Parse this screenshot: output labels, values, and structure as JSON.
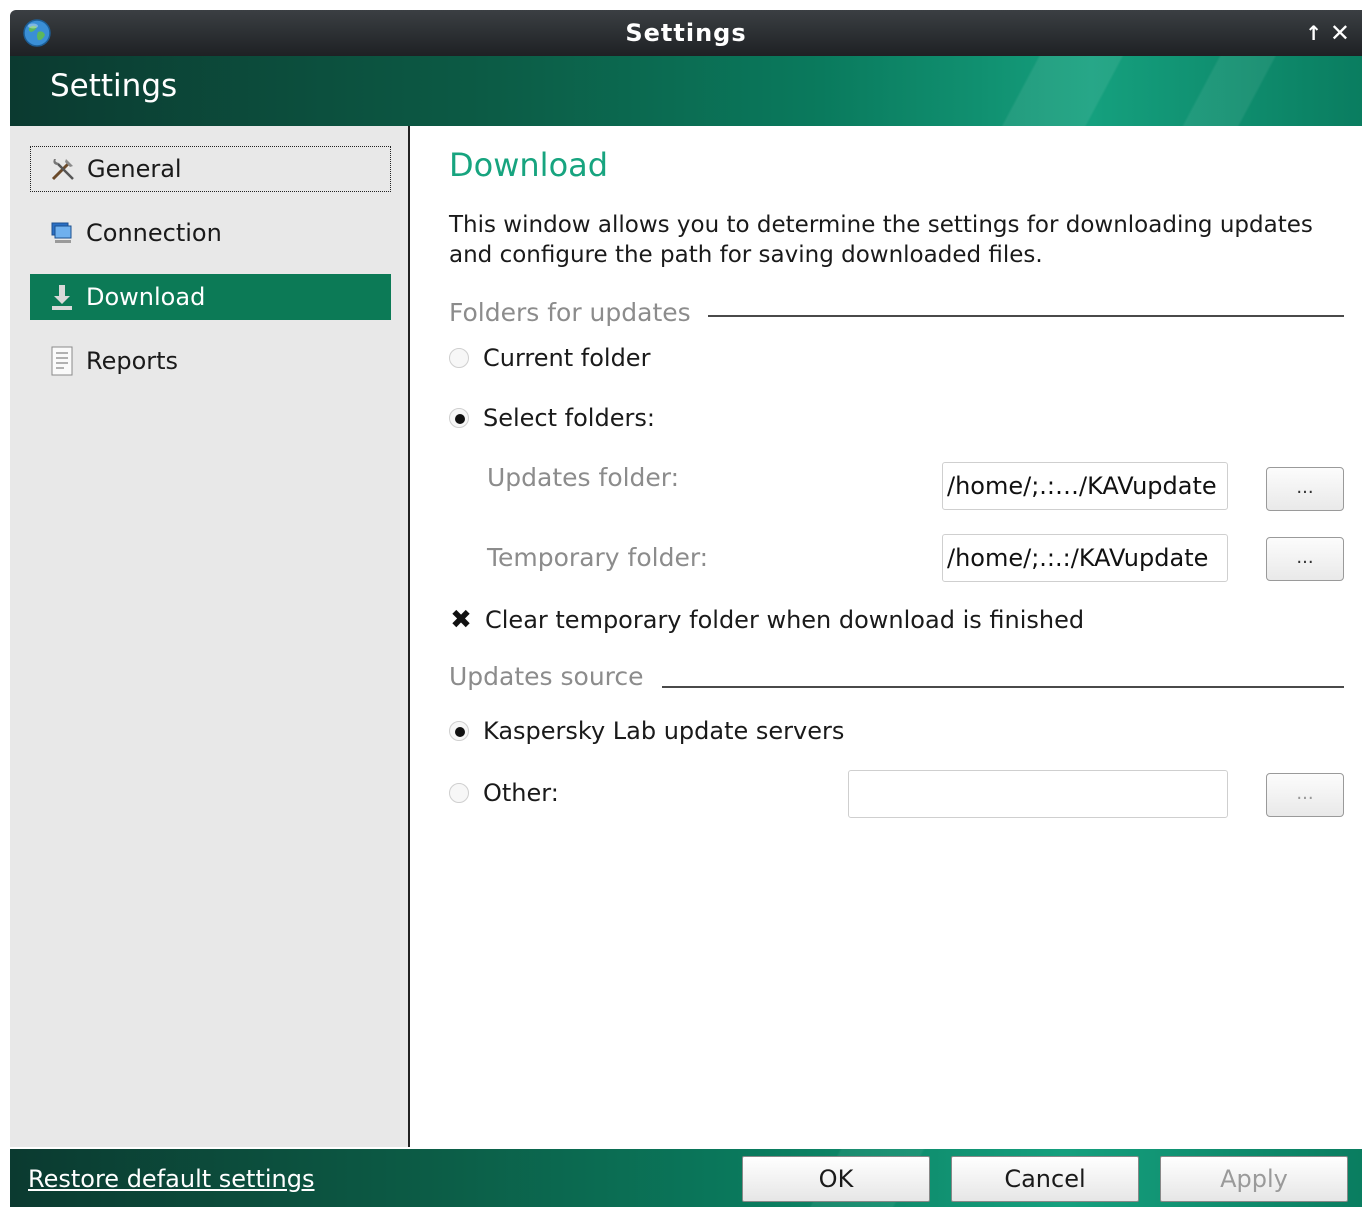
{
  "window": {
    "title": "Settings",
    "icons": {
      "app": "globe-icon",
      "maximize": "up-arrow-icon",
      "close": "close-icon"
    },
    "up_glyph": "↑",
    "close_glyph": "✕"
  },
  "header": {
    "title": "Settings"
  },
  "sidebar": {
    "items": [
      {
        "label": "General",
        "icon": "tools-icon",
        "state": "focused"
      },
      {
        "label": "Connection",
        "icon": "network-icon",
        "state": "normal"
      },
      {
        "label": "Download",
        "icon": "download-icon",
        "state": "selected"
      },
      {
        "label": "Reports",
        "icon": "report-icon",
        "state": "normal"
      }
    ]
  },
  "page": {
    "title": "Download",
    "description": "This window allows you to determine the settings for downloading updates and configure the path for saving downloaded files."
  },
  "folders": {
    "section_title": "Folders for updates",
    "current_folder_label": "Current folder",
    "current_folder_checked": false,
    "select_folders_label": "Select folders:",
    "select_folders_checked": true,
    "updates_folder_label": "Updates folder:",
    "updates_folder_value": "/home/;.:…/KAVupdate",
    "temporary_folder_label": "Temporary folder:",
    "temporary_folder_value": "/home/;.:.:/KAVupdate",
    "browse_label": "...",
    "clear_temp_label": "Clear temporary folder when download is finished",
    "clear_temp_checked": true,
    "check_glyph": "✖"
  },
  "source": {
    "section_title": "Updates source",
    "kaspersky_label": "Kaspersky Lab update servers",
    "kaspersky_checked": true,
    "other_label": "Other:",
    "other_checked": false,
    "other_value": "",
    "browse_label": "..."
  },
  "footer": {
    "restore_label": "Restore default settings",
    "ok_label": "OK",
    "cancel_label": "Cancel",
    "apply_label": "Apply",
    "apply_enabled": false
  },
  "colors": {
    "accent": "#17a47f",
    "selected_bg": "#0c7a56",
    "titlebar": "#2b2f33"
  }
}
